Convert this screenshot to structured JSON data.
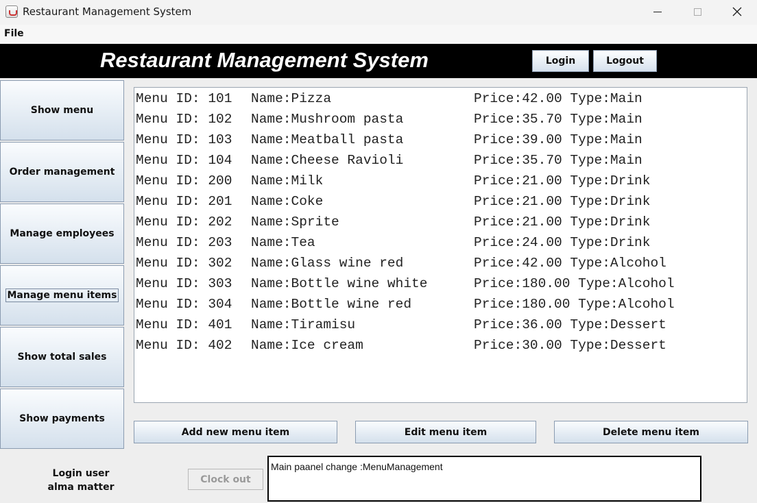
{
  "window": {
    "title": "Restaurant Management System",
    "controls": [
      "minimize-icon",
      "maximize-icon",
      "close-icon"
    ]
  },
  "menubar": {
    "file": "File"
  },
  "header": {
    "title": "Restaurant Management System",
    "login_label": "Login",
    "logout_label": "Logout"
  },
  "sidebar": {
    "items": [
      {
        "label": "Show menu"
      },
      {
        "label": "Order management"
      },
      {
        "label": "Manage employees"
      },
      {
        "label": "Manage menu items"
      },
      {
        "label": "Show total sales"
      },
      {
        "label": "Show payments"
      }
    ]
  },
  "menu_list": {
    "rows": [
      {
        "id": "Menu ID: 101",
        "name": "Name:Pizza",
        "price_type": "Price:42.00 Type:Main"
      },
      {
        "id": "Menu ID: 102",
        "name": "Name:Mushroom pasta",
        "price_type": "Price:35.70 Type:Main"
      },
      {
        "id": "Menu ID: 103",
        "name": "Name:Meatball pasta",
        "price_type": "Price:39.00 Type:Main"
      },
      {
        "id": "Menu ID: 104",
        "name": "Name:Cheese Ravioli",
        "price_type": "Price:35.70 Type:Main"
      },
      {
        "id": "Menu ID: 200",
        "name": "Name:Milk",
        "price_type": "Price:21.00 Type:Drink"
      },
      {
        "id": "Menu ID: 201",
        "name": "Name:Coke",
        "price_type": "Price:21.00 Type:Drink"
      },
      {
        "id": "Menu ID: 202",
        "name": "Name:Sprite",
        "price_type": "Price:21.00 Type:Drink"
      },
      {
        "id": "Menu ID: 203",
        "name": "Name:Tea",
        "price_type": "Price:24.00 Type:Drink"
      },
      {
        "id": "Menu ID: 302",
        "name": "Name:Glass wine red",
        "price_type": "Price:42.00 Type:Alcohol"
      },
      {
        "id": "Menu ID: 303",
        "name": "Name:Bottle wine white",
        "price_type": "Price:180.00 Type:Alcohol"
      },
      {
        "id": "Menu ID: 304",
        "name": "Name:Bottle wine red",
        "price_type": "Price:180.00 Type:Alcohol"
      },
      {
        "id": "Menu ID: 401",
        "name": "Name:Tiramisu",
        "price_type": "Price:36.00 Type:Dessert"
      },
      {
        "id": "Menu ID: 402",
        "name": "Name:Ice cream",
        "price_type": "Price:30.00 Type:Dessert"
      }
    ]
  },
  "actions": {
    "add_label": "Add new menu item",
    "edit_label": "Edit menu item",
    "delete_label": "Delete menu item"
  },
  "footer": {
    "login_user_label": "Login user",
    "login_user_name": "alma matter",
    "clock_out_label": "Clock out",
    "status_text": "Main paanel change :MenuManagement"
  }
}
